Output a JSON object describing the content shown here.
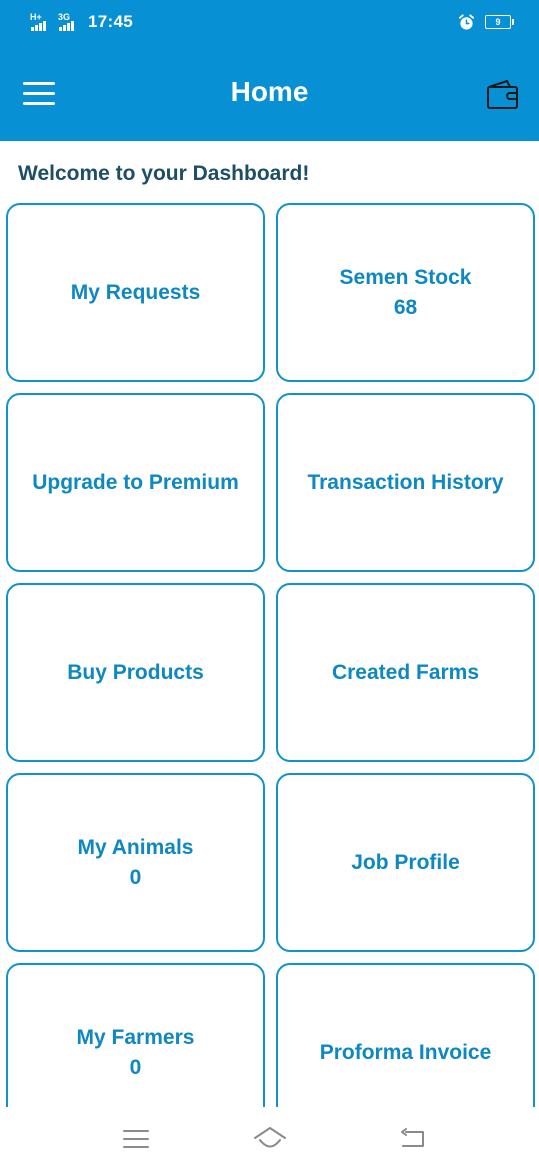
{
  "status_bar": {
    "signal_1_label": "H+",
    "signal_2_label": "3G",
    "time": "17:45",
    "battery_level": "9",
    "icons": [
      "signal-icon",
      "alarm-icon",
      "battery-icon"
    ]
  },
  "app_bar": {
    "title": "Home",
    "menu_icon": "hamburger-menu-icon",
    "wallet_icon": "wallet-icon"
  },
  "dashboard": {
    "welcome": "Welcome to your Dashboard!",
    "cards": [
      {
        "label": "My Requests",
        "count": null
      },
      {
        "label": "Semen Stock",
        "count": "68"
      },
      {
        "label": "Upgrade to Premium",
        "count": null
      },
      {
        "label": "Transaction History",
        "count": null
      },
      {
        "label": "Buy Products",
        "count": null
      },
      {
        "label": "Created Farms",
        "count": null
      },
      {
        "label": "My Animals",
        "count": "0"
      },
      {
        "label": "Job Profile",
        "count": null
      },
      {
        "label": "My Farmers",
        "count": "0"
      },
      {
        "label": "Proforma Invoice",
        "count": null
      }
    ]
  },
  "nav_bar": {
    "icons": [
      "recent-apps-icon",
      "home-icon",
      "back-icon"
    ]
  },
  "colors": {
    "primary": "#0890d5",
    "card_border": "#0e93cf",
    "card_text": "#0e88c3",
    "heading_text": "#1e4d66"
  }
}
